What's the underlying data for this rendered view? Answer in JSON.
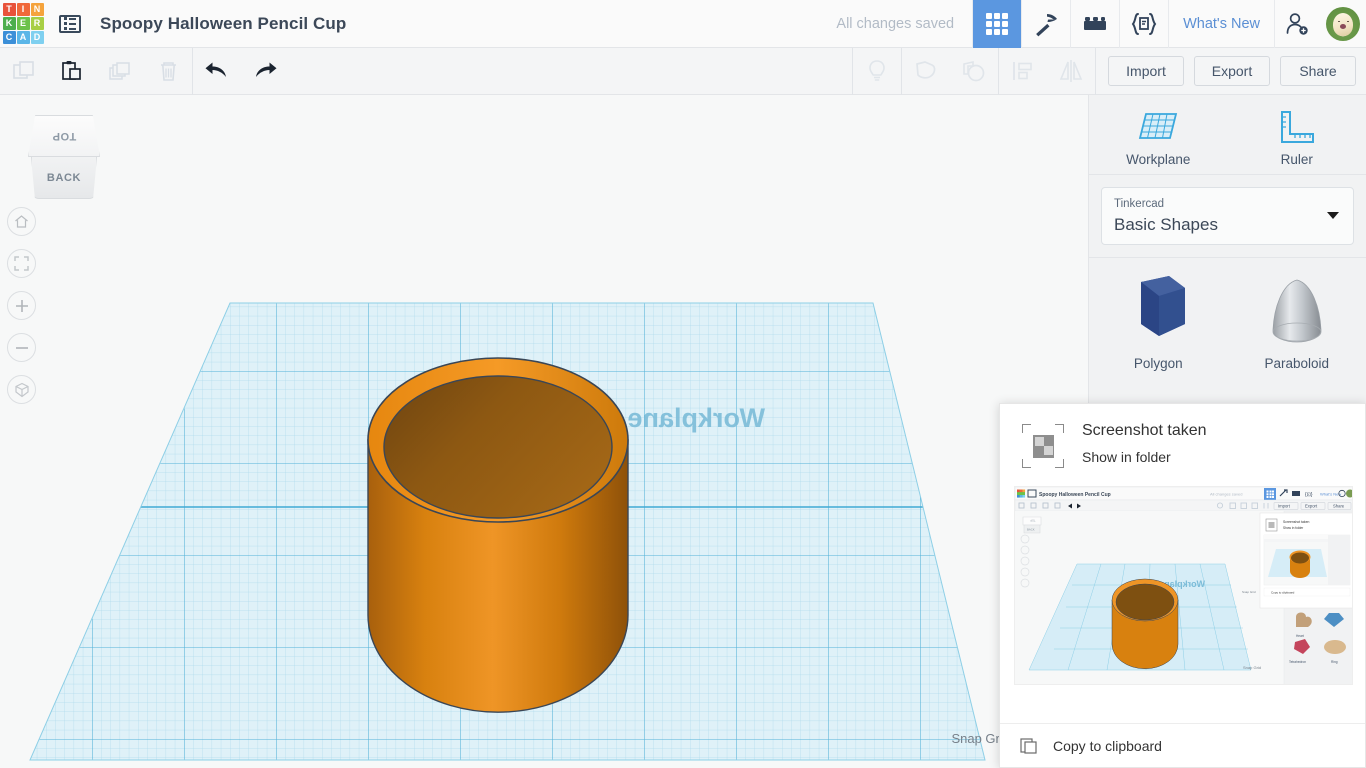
{
  "header": {
    "logo_letters": [
      "T",
      "I",
      "N",
      "K",
      "E",
      "R",
      "C",
      "A",
      "D"
    ],
    "logo_colors": [
      "#e8523a",
      "#f0683a",
      "#f5a33c",
      "#4cae4c",
      "#6cc24a",
      "#a8cf45",
      "#3c8fd8",
      "#5bb6e8",
      "#7fd0f0"
    ],
    "doc_icon": "list-icon",
    "project_title": "Spoopy Halloween Pencil Cup",
    "save_status": "All changes saved",
    "buttons": [
      {
        "name": "design-view-button",
        "icon": "grid-icon",
        "active": true
      },
      {
        "name": "codeblocks-button",
        "icon": "pickaxe-icon",
        "active": false
      },
      {
        "name": "bricks-button",
        "icon": "lego-brick-icon",
        "active": false
      },
      {
        "name": "codeblocks-blocks-button",
        "icon": "code-brackets-icon",
        "active": false
      }
    ],
    "whats_new": "What's New",
    "invite_icon": "person-add-icon",
    "avatar": "dog-avatar"
  },
  "toolbar": {
    "left_tools": [
      {
        "name": "copy-button",
        "icon": "copy-icon",
        "disabled": true
      },
      {
        "name": "paste-button",
        "icon": "paste-icon",
        "disabled": false
      },
      {
        "name": "duplicate-button",
        "icon": "duplicate-icon",
        "disabled": true
      },
      {
        "name": "delete-button",
        "icon": "trash-icon",
        "disabled": true
      },
      {
        "name": "undo-button",
        "icon": "undo-arrow-icon",
        "disabled": false
      },
      {
        "name": "redo-button",
        "icon": "redo-arrow-icon",
        "disabled": false
      }
    ],
    "right_tools": [
      {
        "name": "hide-button",
        "icon": "lightbulb-icon",
        "disabled": true
      },
      {
        "name": "group-button",
        "icon": "group-shapes-icon",
        "disabled": true
      },
      {
        "name": "ungroup-button",
        "icon": "ungroup-shapes-icon",
        "disabled": true
      },
      {
        "name": "align-button",
        "icon": "align-icon",
        "disabled": true
      },
      {
        "name": "mirror-button",
        "icon": "mirror-icon",
        "disabled": true
      }
    ],
    "import_label": "Import",
    "export_label": "Export",
    "share_label": "Share"
  },
  "canvas": {
    "viewcube_top": "TOP",
    "viewcube_back": "BACK",
    "nav_buttons": [
      {
        "name": "home-view-button",
        "icon": "home-icon"
      },
      {
        "name": "fit-view-button",
        "icon": "fit-to-view-icon"
      },
      {
        "name": "zoom-in-button",
        "icon": "plus-icon"
      },
      {
        "name": "zoom-out-button",
        "icon": "minus-icon"
      },
      {
        "name": "perspective-toggle-button",
        "icon": "cube-icon"
      }
    ],
    "workplane_label": "Workplane",
    "snap_grid_label": "Snap Grid",
    "shape_color": "#e3820f",
    "shape_interior_color": "#8a5512",
    "grid_color": "#a8d9ea"
  },
  "panel": {
    "tools": [
      {
        "name": "workplane-tool",
        "label": "Workplane",
        "icon": "workplane-icon"
      },
      {
        "name": "ruler-tool",
        "label": "Ruler",
        "icon": "ruler-icon"
      }
    ],
    "library_sub": "Tinkercad",
    "library_main": "Basic Shapes",
    "shapes": [
      {
        "name": "shape-polygon",
        "label": "Polygon",
        "color": "#2e4b8f"
      },
      {
        "name": "shape-paraboloid",
        "label": "Paraboloid",
        "color": "#bfc3c7"
      }
    ]
  },
  "notification": {
    "title": "Screenshot taken",
    "link": "Show in folder",
    "copy_label": "Copy to clipboard",
    "thumb_icon": "screenshot-thumbnail-icon",
    "copy_icon": "copy-icon"
  }
}
